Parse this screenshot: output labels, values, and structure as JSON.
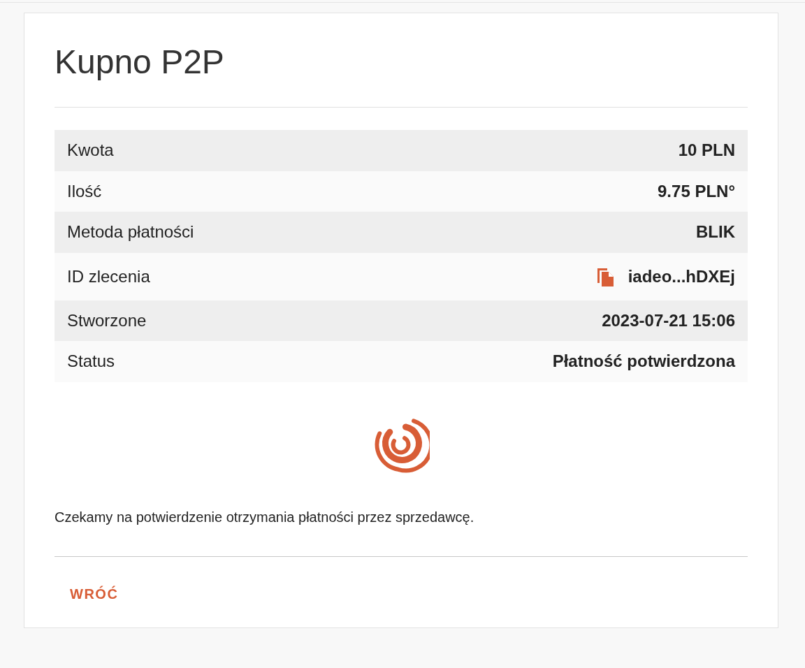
{
  "title": "Kupno P2P",
  "rows": [
    {
      "label": "Kwota",
      "value": "10 PLN",
      "kind": "plain"
    },
    {
      "label": "Ilość",
      "value": "9.75 PLN°",
      "kind": "plain"
    },
    {
      "label": "Metoda płatności",
      "value": "BLIK",
      "kind": "plain"
    },
    {
      "label": "ID zlecenia",
      "value": "iadeo...hDXEj",
      "kind": "copy"
    },
    {
      "label": "Stworzone",
      "value": "2023-07-21 15:06",
      "kind": "plain"
    },
    {
      "label": "Status",
      "value": "Płatność potwierdzona",
      "kind": "plain"
    }
  ],
  "message": "Czekamy na potwierdzenie otrzymania płatności przez sprzedawcę.",
  "back_button": "WRÓĆ"
}
